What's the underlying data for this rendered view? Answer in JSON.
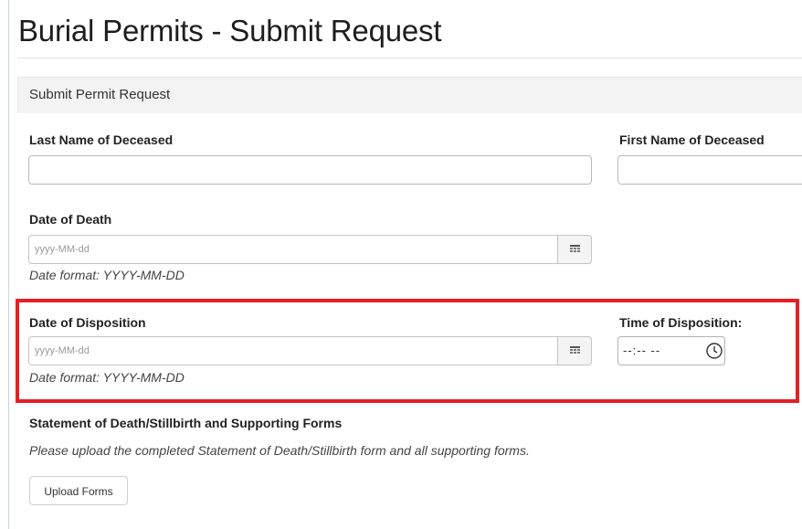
{
  "page": {
    "title": "Burial Permits - Submit Request"
  },
  "panel": {
    "header": "Submit Permit Request"
  },
  "fields": {
    "last_name": {
      "label": "Last Name of Deceased",
      "value": ""
    },
    "first_name": {
      "label": "First Name of Deceased",
      "value": ""
    },
    "date_of_death": {
      "label": "Date of Death",
      "placeholder": "yyyy-MM-dd",
      "hint": "Date format: YYYY-MM-DD",
      "button_icon": "calendar-icon"
    },
    "date_of_disposition": {
      "label": "Date of Disposition",
      "placeholder": "yyyy-MM-dd",
      "hint": "Date format: YYYY-MM-DD",
      "button_icon": "calendar-icon"
    },
    "time_of_disposition": {
      "label": "Time of Disposition:",
      "placeholder": "--:-- --",
      "button_icon": "clock-icon"
    }
  },
  "forms_section": {
    "title": "Statement of Death/Stillbirth and Supporting Forms",
    "description": "Please upload the completed Statement of Death/Stillbirth form and all supporting forms.",
    "upload_button": "Upload Forms"
  },
  "colors": {
    "highlight": "#e51f26",
    "panel_header_bg": "#f3f3f3",
    "border": "#b9b9b9"
  }
}
